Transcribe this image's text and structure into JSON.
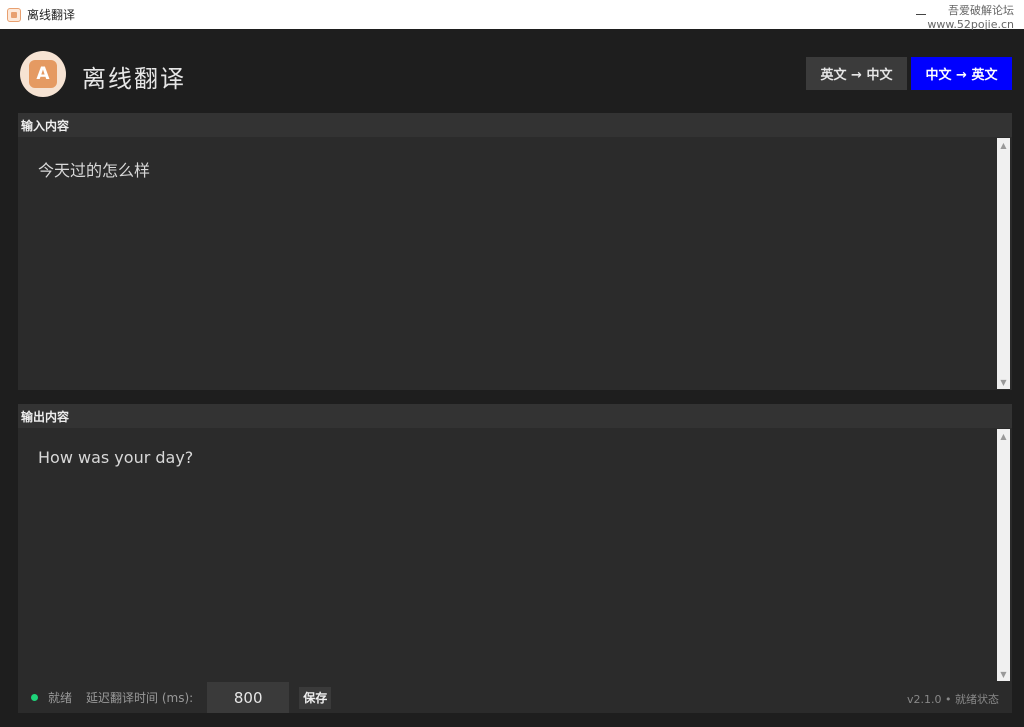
{
  "window": {
    "title": "离线翻译",
    "watermark_line1": "吾爱破解论坛",
    "watermark_line2": "www.52pojie.cn"
  },
  "header": {
    "logo_letter": "A",
    "app_title": "离线翻译",
    "btn_en_zh": "英文 → 中文",
    "btn_zh_en": "中文 → 英文",
    "active_direction_color": "#0000ff"
  },
  "input_panel": {
    "label": "输入内容",
    "text": "今天过的怎么样"
  },
  "output_panel": {
    "label": "输出内容",
    "text": "How was your day?"
  },
  "statusbar": {
    "status": "就绪",
    "status_color": "#1ed47a",
    "delay_label": "延迟翻译时间 (ms):",
    "delay_value": "800",
    "save_label": "保存",
    "version": "v2.1.0 • 就绪状态"
  }
}
